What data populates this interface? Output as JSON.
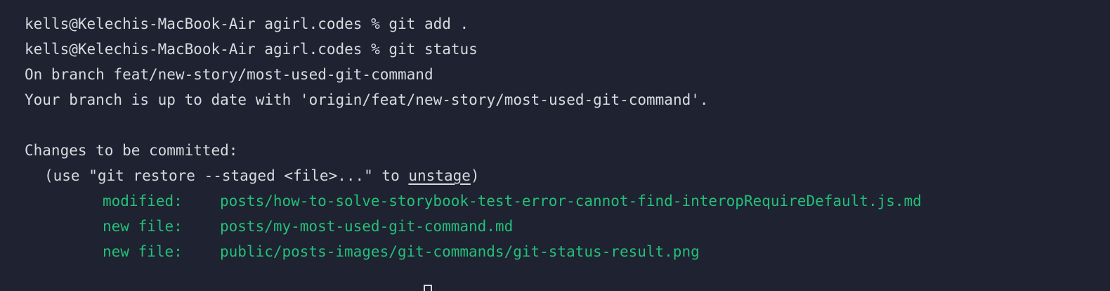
{
  "colors": {
    "background": "#1f2230",
    "text": "#d8dae0",
    "staged": "#22c07a"
  },
  "prompt": "kells@Kelechis-MacBook-Air agirl.codes %",
  "commands": [
    "git add .",
    "git status"
  ],
  "status": {
    "branch_line": "On branch feat/new-story/most-used-git-command",
    "upstream_line": "Your branch is up to date with 'origin/feat/new-story/most-used-git-command'.",
    "section_title": "Changes to be committed:",
    "hint_prefix": "(use \"git restore --staged <file>...\" to ",
    "hint_keyword": "unstage",
    "hint_suffix": ")",
    "files": [
      {
        "status": "modified:",
        "path": "posts/how-to-solve-storybook-test-error-cannot-find-interopRequireDefault.js.md"
      },
      {
        "status": "new file:",
        "path": "posts/my-most-used-git-command.md"
      },
      {
        "status": "new file:",
        "path": "public/posts-images/git-commands/git-status-result.png"
      }
    ]
  }
}
